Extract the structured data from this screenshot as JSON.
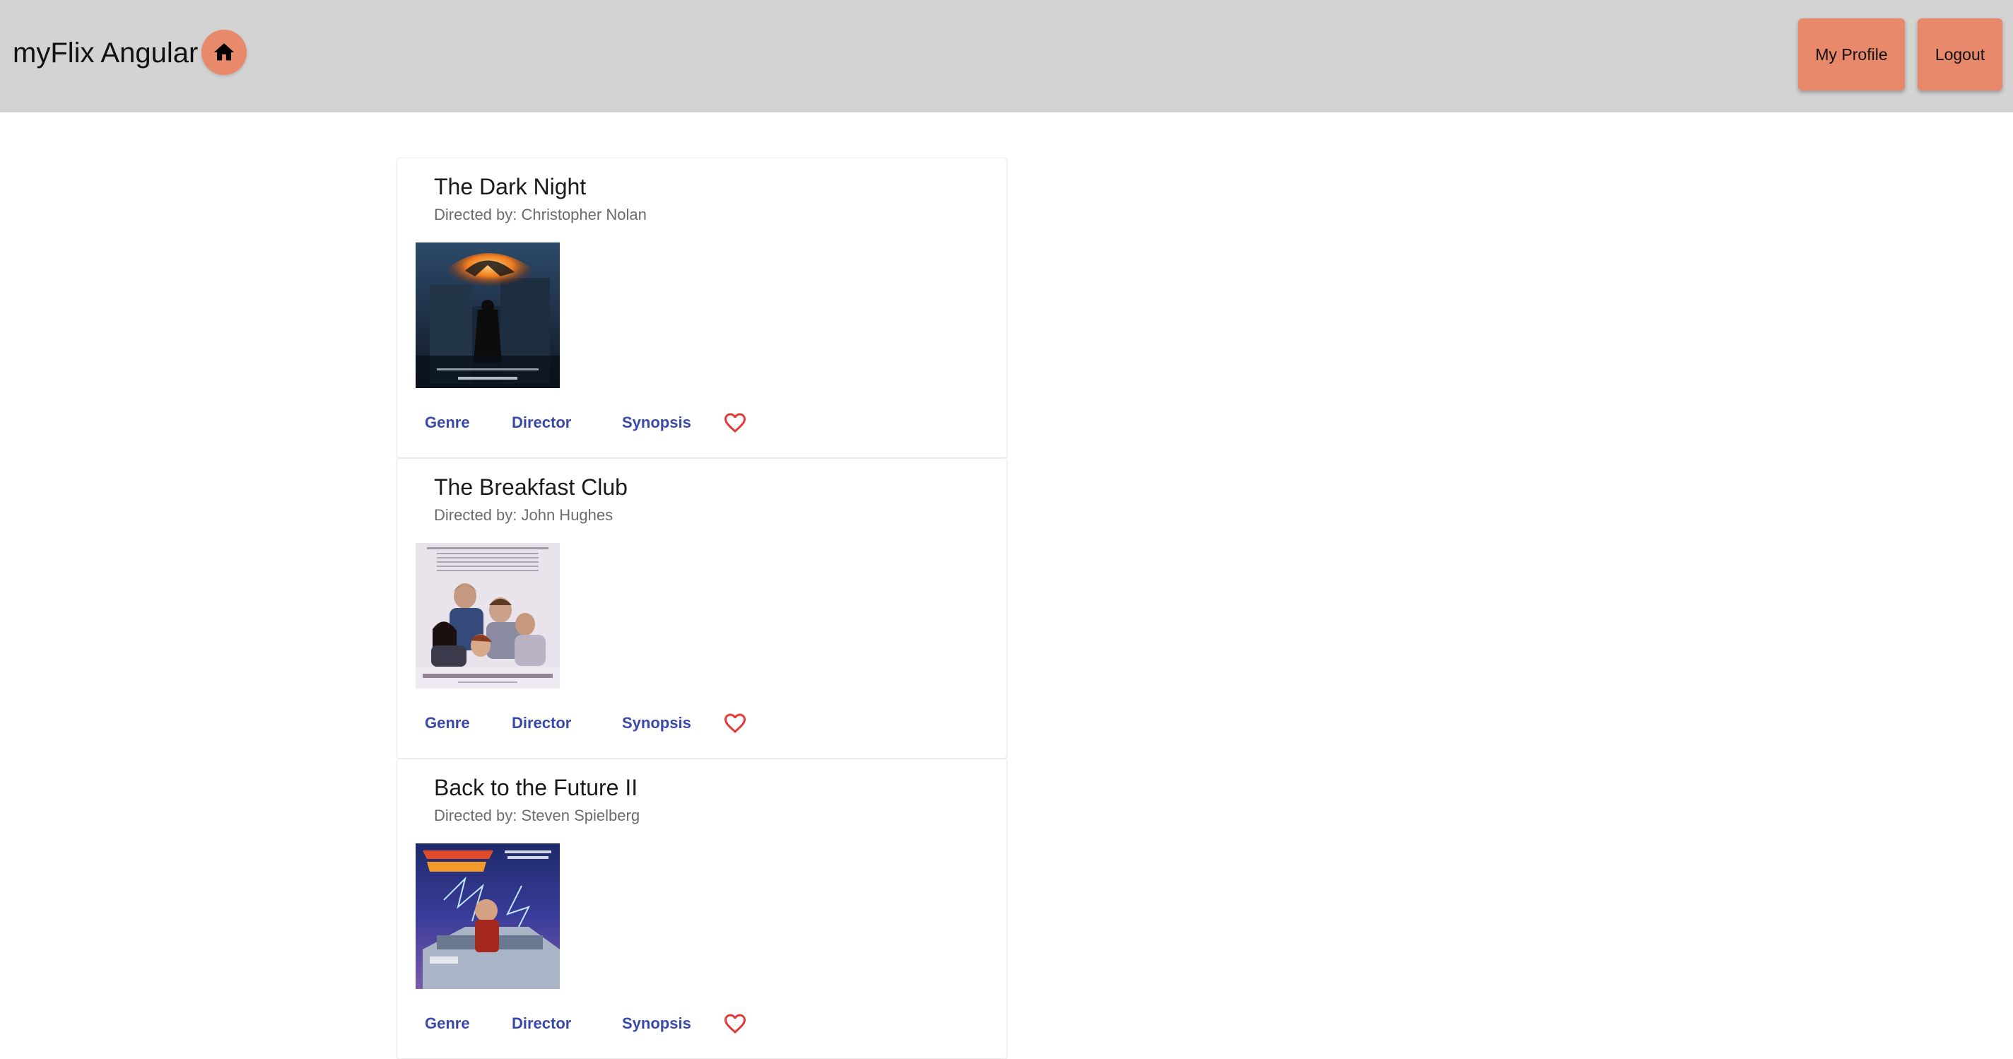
{
  "toolbar": {
    "title": "myFlix Angular",
    "home_icon": "home-icon",
    "profile_label": "My Profile",
    "logout_label": "Logout",
    "bg_color": "#d3d3d3",
    "accent_color": "#e8896b"
  },
  "movies": [
    {
      "title": "The Dark Night",
      "director": "Directed by: Christopher Nolan",
      "actions": {
        "genre": "Genre",
        "director": "Director",
        "synopsis": "Synopsis"
      },
      "favorite_icon": "heart-outline-icon"
    },
    {
      "title": "The Breakfast Club",
      "director": "Directed by: John Hughes",
      "actions": {
        "genre": "Genre",
        "director": "Director",
        "synopsis": "Synopsis"
      },
      "favorite_icon": "heart-outline-icon"
    },
    {
      "title": "Back to the Future II",
      "director": "Directed by: Steven Spielberg",
      "actions": {
        "genre": "Genre",
        "director": "Director",
        "synopsis": "Synopsis"
      },
      "favorite_icon": "heart-outline-icon"
    }
  ],
  "colors": {
    "link": "#3949ab",
    "favorite": "#e53935"
  }
}
